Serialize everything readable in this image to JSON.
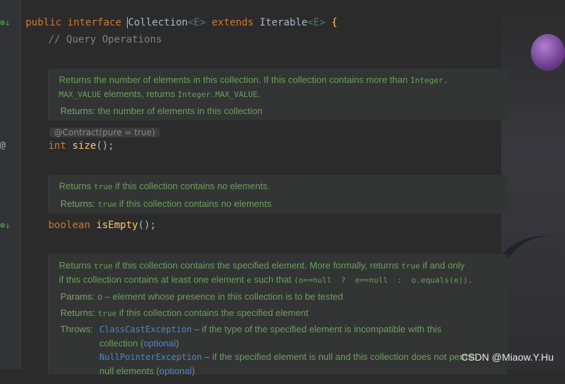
{
  "code": {
    "line1": {
      "public": "public",
      "interface": "interface",
      "name": "Collection",
      "gen1": "<E>",
      "extends": "extends",
      "parent": "Iterable",
      "gen2": "<E>",
      "brace": "{"
    },
    "comment": "// Query Operations",
    "annotation": "@Contract(pure = true)",
    "size_line": {
      "type": "int",
      "name": "size",
      "rest": "();"
    },
    "empty_line": {
      "type": "boolean",
      "name": "isEmpty",
      "rest": "();"
    }
  },
  "gutter": {
    "icon_a": "⊕↓",
    "icon_at": "@",
    "icon_b": "⊕↓"
  },
  "doc1": {
    "text_a": "Returns the number of elements in this collection. If this collection contains more than ",
    "code_a": "Integer.",
    "code_b": "MAX_VALUE",
    "text_b": " elements, returns ",
    "code_c": "Integer.MAX_VALUE",
    "text_c": ".",
    "returns_label": "Returns:",
    "returns_text": "the number of elements in this collection"
  },
  "doc2": {
    "text_a": "Returns ",
    "code_a": "true",
    "text_b": " if this collection contains no elements.",
    "returns_label": "Returns:",
    "returns_code": "true",
    "returns_text": " if this collection contains no elements"
  },
  "doc3": {
    "text_a": "Returns ",
    "code_a": "true",
    "text_b": " if this collection contains the specified element. More formally, returns ",
    "code_b": "true",
    "text_c": " if and only",
    "text_d": "if this collection contains at least one element ",
    "code_c": "e",
    "text_e": " such that ",
    "code_d": "(o==null  ?  e==null  :  o.equals(e)).",
    "params_label": "Params:",
    "params_code": "o",
    "params_text": " – element whose presence in this collection is to be tested",
    "returns_label": "Returns:",
    "returns_code": "true",
    "returns_text": " if this collection contains the specified element",
    "throws_label": "Throws:",
    "throws1_ex": "ClassCastException",
    "throws1_text": " – if the type of the specified element is incompatible with this",
    "throws1_line2": "collection (",
    "optional": "optional",
    "close_paren": ")",
    "throws2_ex": "NullPointerException",
    "throws2_text": " – if the specified element is null and this collection does not permit",
    "throws2_line2": "null elements ("
  },
  "watermark": "CSDN @Miaow.Y.Hu"
}
